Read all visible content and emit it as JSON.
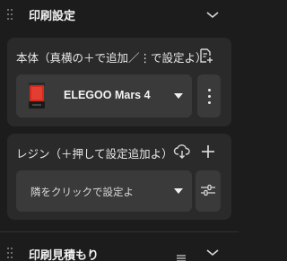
{
  "print_settings": {
    "title": "印刷設定"
  },
  "printer": {
    "label": "本体（真横の＋で追加／⋮で設定よ）",
    "selected": "ELEGOO Mars 4",
    "thumb_color": "#d42a1e"
  },
  "resin": {
    "label": "レジン（＋押して設定追加よ）",
    "placeholder": "隣をクリックで設定よ"
  },
  "estimate": {
    "title": "印刷見積もり"
  }
}
